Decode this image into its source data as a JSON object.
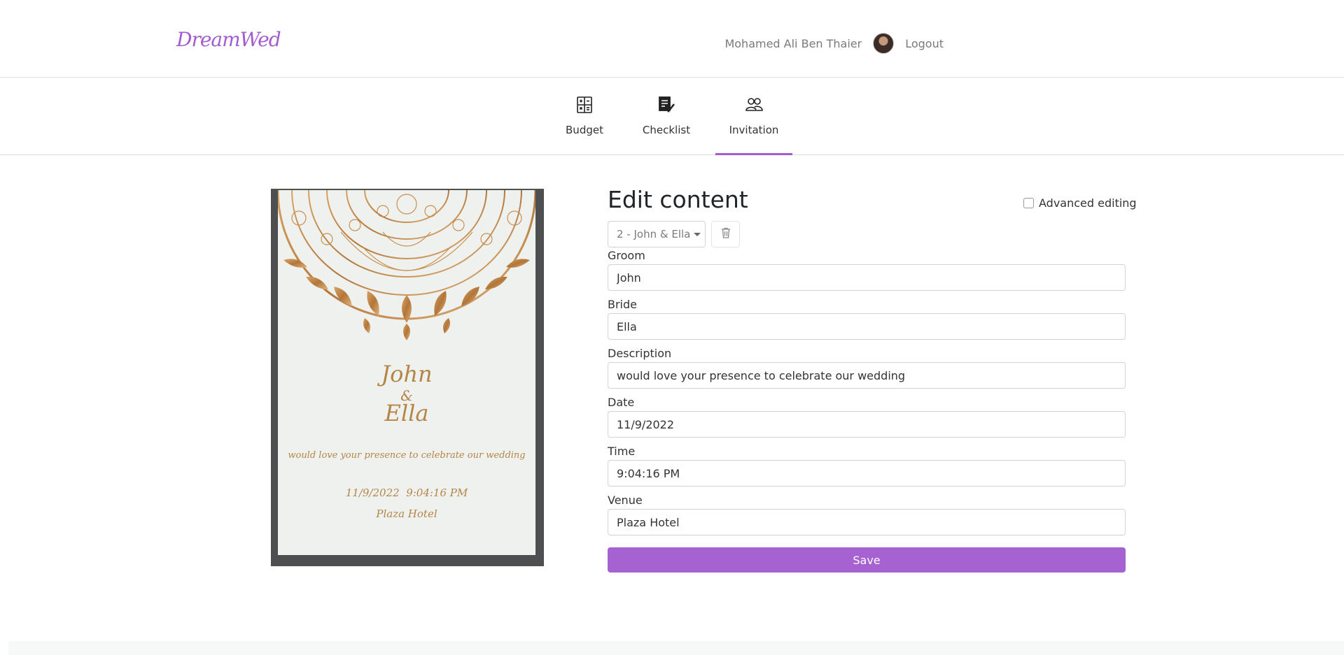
{
  "header": {
    "logo": "DreamWed",
    "user_name": "Mohamed Ali Ben Thaier",
    "logout_label": "Logout"
  },
  "tabs": [
    {
      "label": "Budget",
      "icon": "calculator-icon"
    },
    {
      "label": "Checklist",
      "icon": "checklist-icon"
    },
    {
      "label": "Invitation",
      "icon": "people-icon",
      "active": true
    }
  ],
  "invitation_card": {
    "groom": "John",
    "ampersand": "&",
    "bride": "Ella",
    "description": "would love your presence to celebrate our wedding",
    "date_time": "11/9/2022  9:04:16 PM",
    "venue": "Plaza Hotel"
  },
  "editor": {
    "title": "Edit content",
    "advanced_editing_label": "Advanced editing",
    "advanced_editing_checked": false,
    "selected_invitation": "2 - John & Ella",
    "fields": {
      "groom": {
        "label": "Groom",
        "value": "John"
      },
      "bride": {
        "label": "Bride",
        "value": "Ella"
      },
      "description": {
        "label": "Description",
        "value": "would love your presence to celebrate our wedding"
      },
      "date": {
        "label": "Date",
        "value": "11/9/2022"
      },
      "time": {
        "label": "Time",
        "value": "9:04:16 PM"
      },
      "venue": {
        "label": "Venue",
        "value": "Plaza Hotel"
      }
    },
    "save_label": "Save"
  },
  "colors": {
    "brand": "#a25ccf",
    "save_button": "#a662d1",
    "card_gold": "#b48547"
  }
}
